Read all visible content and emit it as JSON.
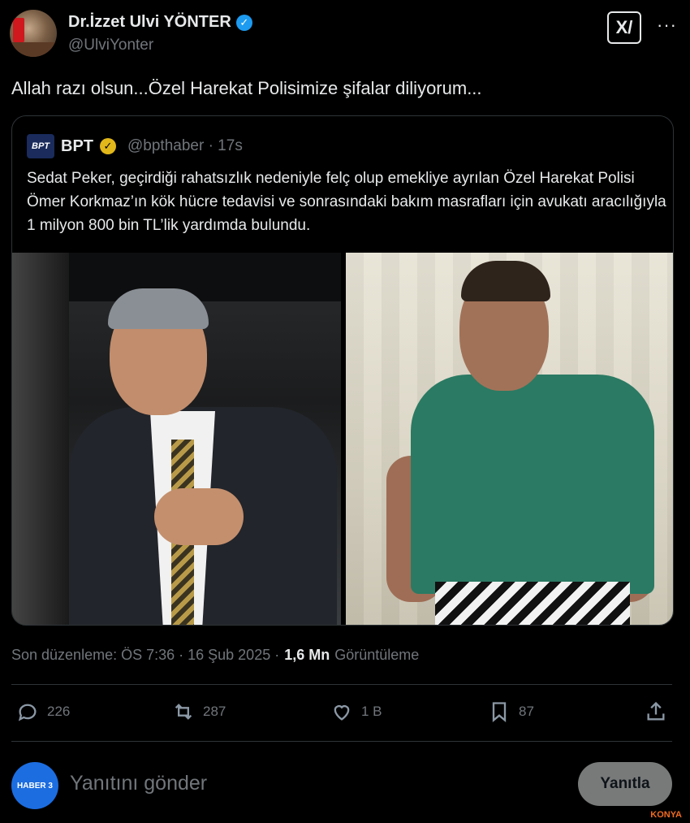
{
  "author": {
    "display_name": "Dr.İzzet Ulvi YÖNTER",
    "handle": "@UlviYonter"
  },
  "header": {
    "grok_label": "X/",
    "more_label": "···"
  },
  "tweet": {
    "text": "Allah razı olsun...Özel Harekat Polisimize şifalar diliyorum..."
  },
  "quote": {
    "logo_text": "BPT",
    "name": "BPT",
    "handle_time": "@bpthaber · 17s",
    "text": "Sedat Peker, geçirdiği rahatsızlık nedeniyle felç olup emekliye ayrılan Özel Harekat Polisi Ömer Korkmaz’ın kök hücre tedavisi ve sonrasındaki bakım masrafları için avukatı aracılığıyla 1 milyon 800 bin TL’lik yardımda bulundu."
  },
  "meta": {
    "edited": "Son düzenleme: ÖS 7:36 · 16 Şub 2025 ·",
    "views_count": "1,6 Mn",
    "views_label": "Görüntüleme"
  },
  "actions": {
    "replies": "226",
    "reposts": "287",
    "likes": "1 B",
    "bookmarks": "87"
  },
  "reply_bar": {
    "avatar_text": "HABER 3",
    "placeholder": "Yanıtını gönder",
    "button": "Yanıtla",
    "watermark": "KONYA"
  },
  "colors": {
    "background": "#000000",
    "text": "#e7e9ea",
    "muted": "#71767b",
    "verified": "#1d9bf0",
    "gold_verified": "#e2b719"
  }
}
